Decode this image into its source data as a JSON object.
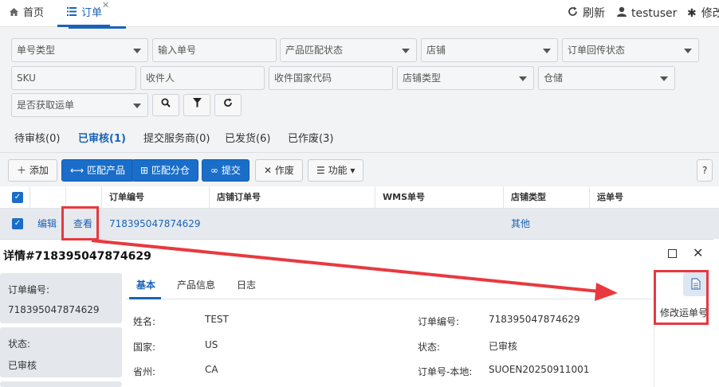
{
  "topbar": {
    "tabs": [
      {
        "label": "首页",
        "icon": "home-icon"
      },
      {
        "label": "订单",
        "icon": "list-icon",
        "active": true
      }
    ],
    "refresh_label": "刷新",
    "username": "testuser",
    "settings_label": "修改"
  },
  "filters": {
    "row1": [
      {
        "placeholder": "单号类型",
        "type": "select"
      },
      {
        "placeholder": "输入单号",
        "type": "input"
      },
      {
        "placeholder": "产品匹配状态",
        "type": "select"
      },
      {
        "placeholder": "店铺",
        "type": "select"
      },
      {
        "placeholder": "订单回传状态",
        "type": "select"
      }
    ],
    "row2": [
      {
        "placeholder": "SKU",
        "type": "input"
      },
      {
        "placeholder": "收件人",
        "type": "input"
      },
      {
        "placeholder": "收件国家代码",
        "type": "input"
      },
      {
        "placeholder": "店铺类型",
        "type": "select"
      },
      {
        "placeholder": "仓储",
        "type": "select"
      }
    ],
    "row3": [
      {
        "placeholder": "是否获取运单",
        "type": "select"
      }
    ]
  },
  "status_tabs": [
    {
      "label": "待审核(0)"
    },
    {
      "label": "已审核(1)",
      "active": true
    },
    {
      "label": "提交服务商(0)"
    },
    {
      "label": "已发货(6)"
    },
    {
      "label": "已作废(3)"
    }
  ],
  "actions": {
    "add": "添加",
    "match_product": "匹配产品",
    "match_warehouse": "匹配分仓",
    "submit": "提交",
    "void": "作废",
    "functions": "功能",
    "help": "?"
  },
  "table": {
    "headers": [
      "订单编号",
      "店铺订单号",
      "WMS单号",
      "店铺类型",
      "运单号"
    ],
    "rows": [
      {
        "edit": "编辑",
        "view": "查看",
        "order_no": "718395047874629",
        "shop_order_no": "",
        "wms_no": "",
        "shop_type": "其他",
        "waybill_no": ""
      }
    ]
  },
  "detail": {
    "title": "详情#718395047874629",
    "left_cards": [
      {
        "label": "订单编号:",
        "value": "718395047874629"
      },
      {
        "label": "状态:",
        "value": "已审核"
      }
    ],
    "tabs": [
      {
        "label": "基本",
        "active": true
      },
      {
        "label": "产品信息"
      },
      {
        "label": "日志"
      }
    ],
    "fields_left": [
      {
        "label": "姓名:",
        "value": "TEST"
      },
      {
        "label": "国家:",
        "value": "US"
      },
      {
        "label": "省州:",
        "value": "CA"
      }
    ],
    "fields_right": [
      {
        "label": "订单编号:",
        "value": "718395047874629"
      },
      {
        "label": "状态:",
        "value": "已审核"
      },
      {
        "label": "订单号-本地:",
        "value": "SUOEN20250911001"
      }
    ],
    "modify_waybill_label": "修改运单号"
  },
  "colors": {
    "accent": "#1a63b8",
    "button_blue": "#1a6ec9",
    "annotation_red": "#e8393f",
    "background": "#f2f3f5"
  }
}
